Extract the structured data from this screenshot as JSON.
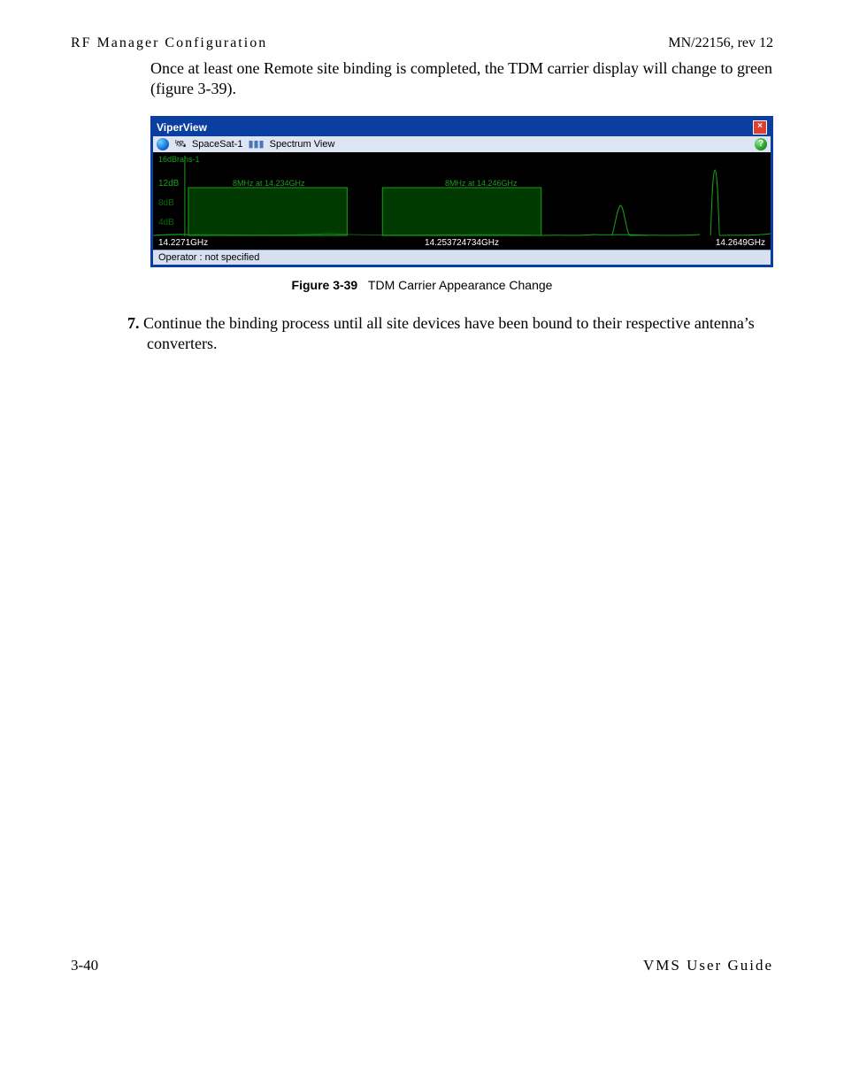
{
  "header": {
    "section": "RF Manager Configuration",
    "doc_id": "MN/22156, rev 12"
  },
  "intro_text": "Once at least one Remote site binding is completed, the TDM carrier display will change to green (figure 3-39).",
  "window": {
    "title": "ViperView",
    "close_glyph": "×",
    "breadcrumb": {
      "sat": "SpaceSat-1",
      "bars_glyph": "▮▮▮",
      "view": "Spectrum View",
      "help_glyph": "?"
    },
    "spectrum": {
      "trans_label": "16dBrans-1",
      "y_ticks": [
        "12dB",
        "8dB",
        "4dB"
      ],
      "x_left": "14.2271GHz",
      "x_center": "14.253724734GHz",
      "x_right": "14.2649GHz",
      "carrier1": "8MHz at 14.234GHz",
      "carrier2": "8MHz at 14.246GHz"
    },
    "status": "Operator : not specified"
  },
  "figure": {
    "label": "Figure 3-39",
    "caption": "TDM Carrier Appearance Change"
  },
  "step": {
    "num": "7.",
    "text": " Continue the binding process until all site devices have been bound to their respective antenna’s converters."
  },
  "footer": {
    "page": "3-40",
    "guide": "VMS User Guide"
  }
}
